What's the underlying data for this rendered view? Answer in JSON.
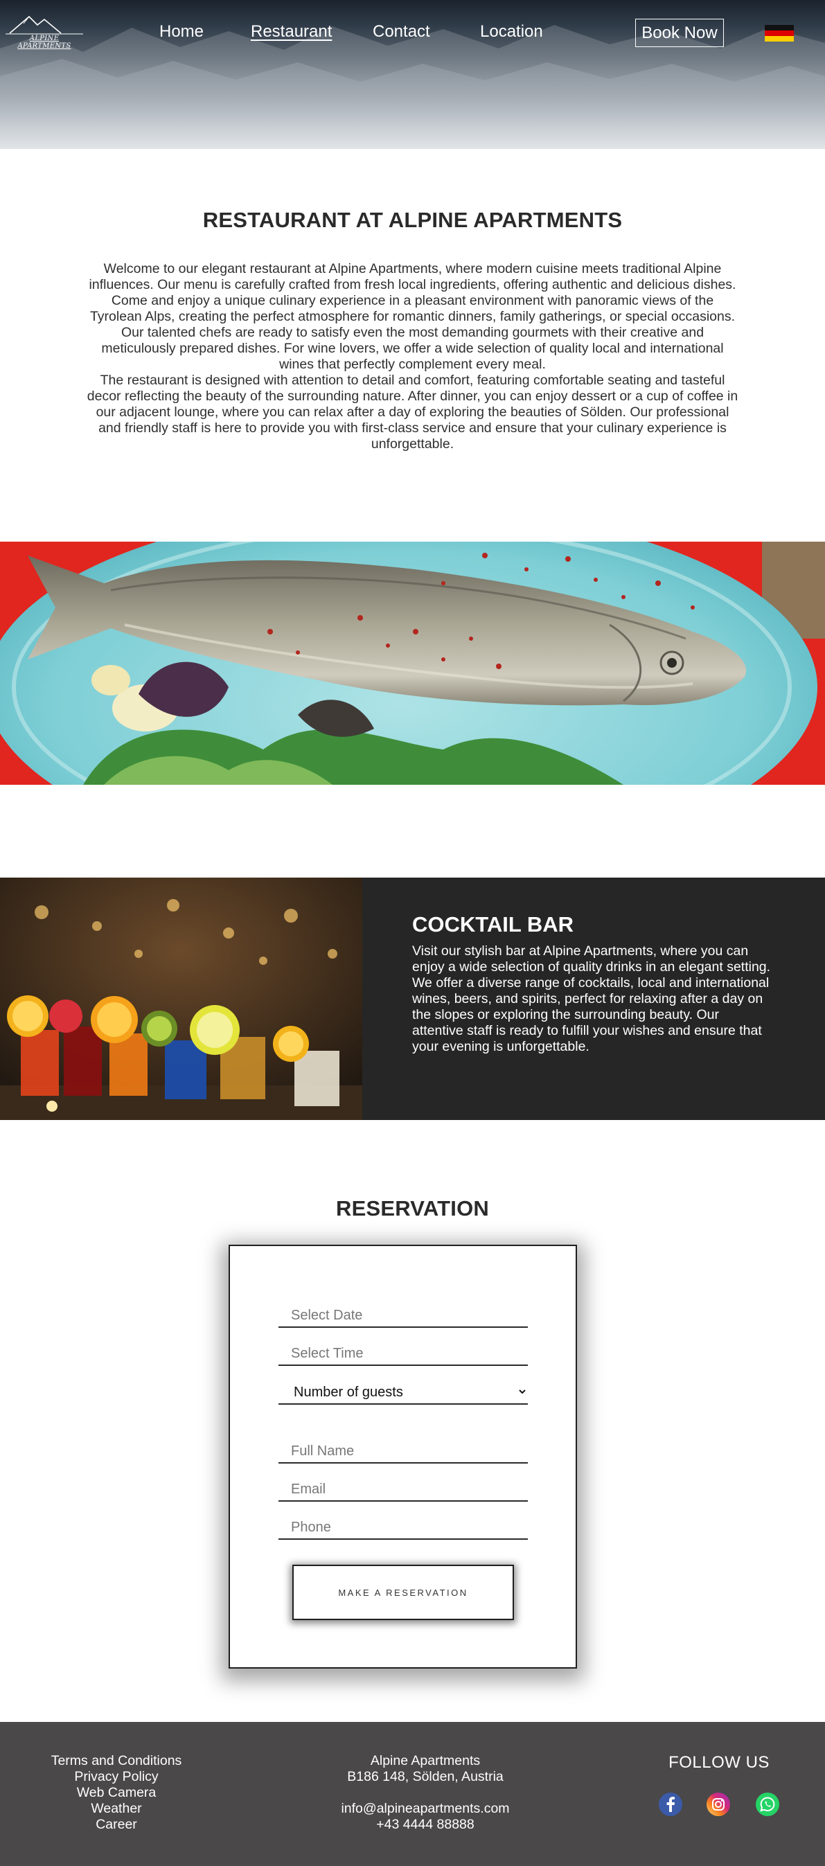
{
  "header": {
    "logo_text": "ALPINE APARTMENTS",
    "nav": [
      {
        "label": "Home"
      },
      {
        "label": "Restaurant",
        "active": true
      },
      {
        "label": "Contact"
      },
      {
        "label": "Location"
      }
    ],
    "book_now": "Book Now",
    "language_flag": "german-flag"
  },
  "restaurant": {
    "title": "RESTAURANT AT ALPINE APARTMENTS",
    "paragraphs": [
      "Welcome to our elegant restaurant at Alpine Apartments, where modern cuisine meets traditional Alpine influences. Our menu is carefully crafted from fresh local ingredients, offering authentic and delicious dishes. Come and enjoy a unique culinary experience in a pleasant environment with panoramic views of the Tyrolean Alps, creating the perfect atmosphere for romantic dinners, family gatherings, or special occasions.",
      "Our talented chefs are ready to satisfy even the most demanding gourmets with their creative and meticulously prepared dishes. For wine lovers, we offer a wide selection of quality local and international wines that perfectly complement every meal.",
      "The restaurant is designed with attention to detail and comfort, featuring comfortable seating and tasteful decor reflecting the beauty of the surrounding nature. After dinner, you can enjoy dessert or a cup of coffee in our adjacent lounge, where you can relax after a day of exploring the beauties of Sölden. Our professional and friendly staff is here to provide you with first-class service and ensure that your culinary experience is unforgettable."
    ]
  },
  "cocktail_bar": {
    "title": "COCKTAIL BAR",
    "text": "Visit our stylish bar at Alpine Apartments, where you can enjoy a wide selection of quality drinks in an elegant setting. We offer a diverse range of cocktails, local and international wines, beers, and spirits, perfect for relaxing after a day on the slopes or exploring the surrounding beauty. Our attentive staff is ready to fulfill your wishes and ensure that your evening is unforgettable."
  },
  "reservation": {
    "title": "RESERVATION",
    "date_placeholder": "Select Date",
    "time_placeholder": "Select Time",
    "guests_selected": "Number of guests",
    "name_placeholder": "Full Name",
    "email_placeholder": "Email",
    "phone_placeholder": "Phone",
    "submit_label": "MAKE A RESERVATION"
  },
  "footer": {
    "links": [
      "Terms and Conditions",
      "Privacy Policy",
      "Web Camera",
      "Weather",
      "Career"
    ],
    "company": "Alpine Apartments",
    "address": "B186 148, Sölden, Austria",
    "email": "info@alpineapartments.com",
    "phone": "+43 4444 88888",
    "follow_label": "FOLLOW US",
    "social_icons": [
      "facebook-icon",
      "instagram-icon",
      "whatsapp-icon"
    ]
  },
  "colors": {
    "bar_background": "#262626",
    "footer_background": "#4a4849",
    "facebook": "#3b5ba9",
    "whatsapp": "#25d366"
  }
}
